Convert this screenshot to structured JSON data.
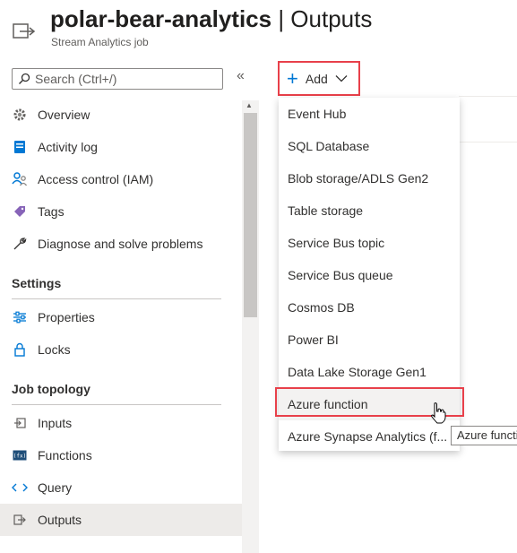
{
  "header": {
    "resource_name": "polar-bear-analytics",
    "separator": " | ",
    "page": "Outputs",
    "subtitle": "Stream Analytics job"
  },
  "search": {
    "placeholder": "Search (Ctrl+/)",
    "collapse_glyph": "«"
  },
  "nav": {
    "items": [
      {
        "label": "Overview",
        "icon": "gear-icon"
      },
      {
        "label": "Activity log",
        "icon": "activity-log-icon"
      },
      {
        "label": "Access control (IAM)",
        "icon": "people-icon"
      },
      {
        "label": "Tags",
        "icon": "tag-icon"
      },
      {
        "label": "Diagnose and solve problems",
        "icon": "wrench-icon"
      }
    ],
    "settings_heading": "Settings",
    "settings_items": [
      {
        "label": "Properties",
        "icon": "sliders-icon"
      },
      {
        "label": "Locks",
        "icon": "lock-icon"
      }
    ],
    "topology_heading": "Job topology",
    "topology_items": [
      {
        "label": "Inputs",
        "icon": "input-icon"
      },
      {
        "label": "Functions",
        "icon": "function-icon"
      },
      {
        "label": "Query",
        "icon": "code-icon"
      },
      {
        "label": "Outputs",
        "icon": "output-icon",
        "selected": true
      }
    ]
  },
  "toolbar": {
    "add_label": "Add"
  },
  "dropdown": {
    "items": [
      "Event Hub",
      "SQL Database",
      "Blob storage/ADLS Gen2",
      "Table storage",
      "Service Bus topic",
      "Service Bus queue",
      "Cosmos DB",
      "Power BI",
      "Data Lake Storage Gen1",
      "Azure function",
      "Azure Synapse Analytics (f..."
    ],
    "hovered_item": "Azure function"
  },
  "tooltip": {
    "text": "Azure functi"
  },
  "colors": {
    "accent": "#0078d4",
    "highlight_border": "#e8404a",
    "selected_bg": "#edebe9"
  }
}
